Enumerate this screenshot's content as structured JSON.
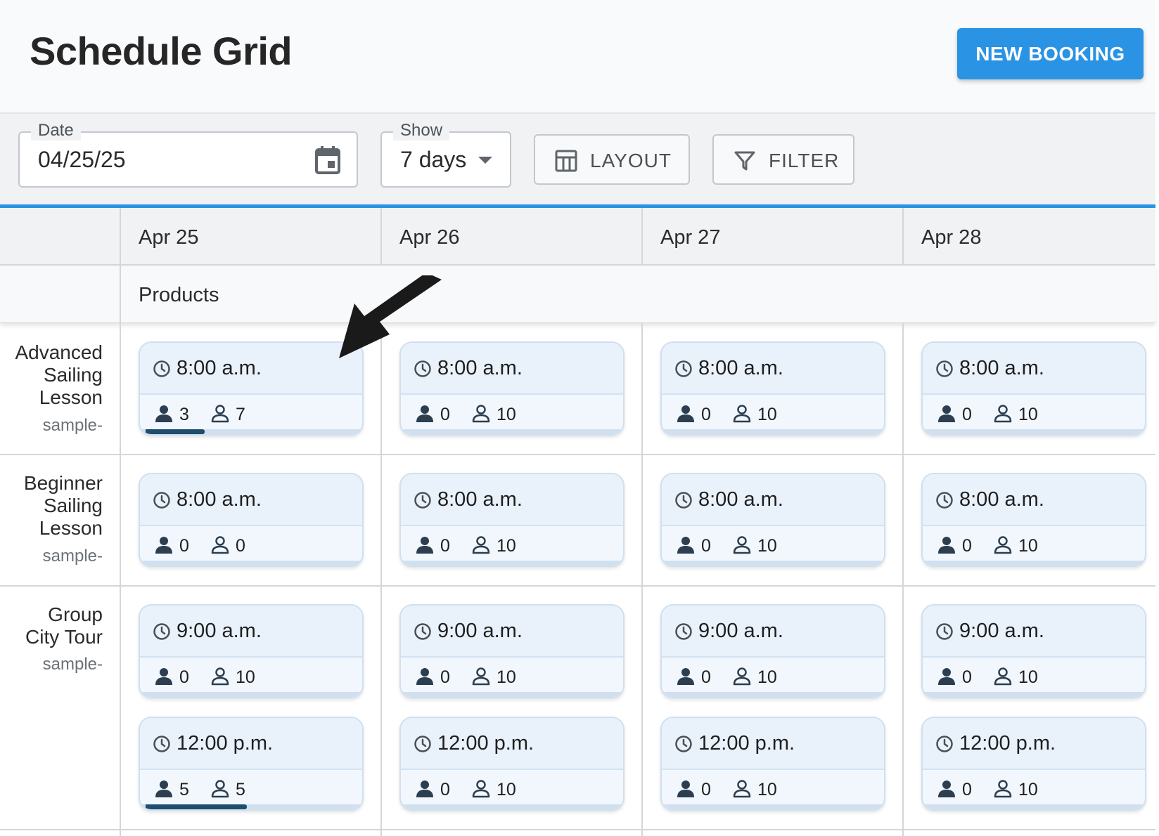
{
  "header": {
    "title": "Schedule Grid",
    "new_booking_label": "NEW BOOKING"
  },
  "toolbar": {
    "date_label": "Date",
    "date_value": "04/25/25",
    "show_label": "Show",
    "show_value": "7 days",
    "layout_label": "LAYOUT",
    "filter_label": "FILTER"
  },
  "grid": {
    "dates": [
      "Apr 25",
      "Apr 26",
      "Apr 27",
      "Apr 28"
    ],
    "products_label": "Products",
    "products": [
      {
        "name": "Advanced Sailing Lesson",
        "name_lines": [
          "Advanced",
          "Sailing",
          "Lesson"
        ],
        "sub": "sample-",
        "slots": [
          [
            {
              "time": "8:00 a.m.",
              "booked": "3",
              "available": "7",
              "fill": 0.28
            },
            {
              "time": "8:00 a.m.",
              "booked": "0",
              "available": "10",
              "fill": 0
            },
            {
              "time": "8:00 a.m.",
              "booked": "0",
              "available": "10",
              "fill": 0
            },
            {
              "time": "8:00 a.m.",
              "booked": "0",
              "available": "10",
              "fill": 0
            }
          ]
        ]
      },
      {
        "name": "Beginner Sailing Lesson",
        "name_lines": [
          "Beginner",
          "Sailing",
          "Lesson"
        ],
        "sub": "sample-",
        "slots": [
          [
            {
              "time": "8:00 a.m.",
              "booked": "0",
              "available": "0",
              "fill": 0
            },
            {
              "time": "8:00 a.m.",
              "booked": "0",
              "available": "10",
              "fill": 0
            },
            {
              "time": "8:00 a.m.",
              "booked": "0",
              "available": "10",
              "fill": 0
            },
            {
              "time": "8:00 a.m.",
              "booked": "0",
              "available": "10",
              "fill": 0
            }
          ]
        ]
      },
      {
        "name": "Group City Tour",
        "name_lines": [
          "Group",
          "City Tour"
        ],
        "sub": "sample-",
        "slots": [
          [
            {
              "time": "9:00 a.m.",
              "booked": "0",
              "available": "10",
              "fill": 0
            },
            {
              "time": "9:00 a.m.",
              "booked": "0",
              "available": "10",
              "fill": 0
            },
            {
              "time": "9:00 a.m.",
              "booked": "0",
              "available": "10",
              "fill": 0
            },
            {
              "time": "9:00 a.m.",
              "booked": "0",
              "available": "10",
              "fill": 0
            }
          ],
          [
            {
              "time": "12:00 p.m.",
              "booked": "5",
              "available": "5",
              "fill": 0.48
            },
            {
              "time": "12:00 p.m.",
              "booked": "0",
              "available": "10",
              "fill": 0
            },
            {
              "time": "12:00 p.m.",
              "booked": "0",
              "available": "10",
              "fill": 0
            },
            {
              "time": "12:00 p.m.",
              "booked": "0",
              "available": "10",
              "fill": 0
            }
          ]
        ]
      }
    ]
  },
  "colors": {
    "accent": "#2a93e3",
    "progress": "#1e4d6e",
    "card_bg": "#f2f7fd"
  },
  "icons": [
    "calendar-icon",
    "chevron-down-icon",
    "layout-icon",
    "filter-icon",
    "clock-icon",
    "person-filled-icon",
    "person-outline-icon",
    "arrow-annotation"
  ]
}
